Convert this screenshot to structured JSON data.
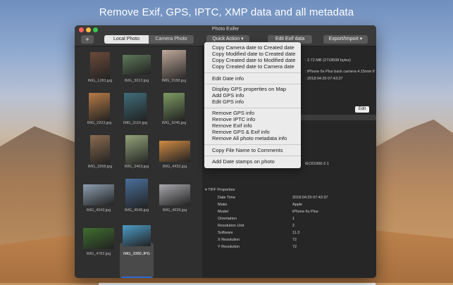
{
  "banner": "Remove Exif, GPS, IPTC, XMP data and all metadata",
  "window": {
    "title": "Photo Exifer"
  },
  "toolbar": {
    "add_label": "+",
    "segment_local": "Local Photo",
    "segment_camera": "Camera Photo",
    "quick_action": "Quick Action ▾",
    "edit_exif": "Edit Exif data",
    "export_import": "Export/Import ▾"
  },
  "photos": [
    {
      "name": "IMG_1283.jpg",
      "color": "#6b4a3a"
    },
    {
      "name": "IMG_3012.jpg",
      "color": "#5f7a5a"
    },
    {
      "name": "IMG_3188.jpg",
      "color": "#bfa89a"
    },
    {
      "name": "IMG_2223.jpg",
      "color": "#b77b47"
    },
    {
      "name": "IMG_3110.jpg",
      "color": "#3f6d7a"
    },
    {
      "name": "IMG_3245.jpg",
      "color": "#7e9b63"
    },
    {
      "name": "IMG_3268.jpg",
      "color": "#8a6b4f"
    },
    {
      "name": "IMG_3463.jpg",
      "color": "#94a47a"
    },
    {
      "name": "IMG_4432.jpg",
      "color": "#d18b44"
    },
    {
      "name": "IMG_4543.jpg",
      "color": "#8e9fb1"
    },
    {
      "name": "IMG_4546.jpg",
      "color": "#4a6f9b"
    },
    {
      "name": "IMG_4639.jpg",
      "color": "#a9a9ae"
    },
    {
      "name": "IMG_4782.jpg",
      "color": "#3f6e2e"
    },
    {
      "name": "IMG_3380.JPG",
      "color": "#4d9cc7"
    }
  ],
  "info": {
    "size": ": 2.72 MB (2718508 bytes)",
    "camera": ": iPhone 6s Plus back camera 4.15mm f/",
    "date": ": 2018:04:20 07:43:37",
    "edit": "Edit",
    "color_profile": "IEC61966-2.1"
  },
  "tiff": {
    "heading": "▾ TIFF Properties",
    "rows": [
      {
        "label": "Date Time",
        "value": "2018:04:20 07:43:37"
      },
      {
        "label": "Make",
        "value": "Apple"
      },
      {
        "label": "Model",
        "value": "iPhone 6s Plus"
      },
      {
        "label": "Orientation",
        "value": "1"
      },
      {
        "label": "Resolution Unit",
        "value": "2"
      },
      {
        "label": "Software",
        "value": "11.3"
      },
      {
        "label": "X Resolution",
        "value": "72"
      },
      {
        "label": "Y Resolution",
        "value": "72"
      }
    ]
  },
  "menu": {
    "items": [
      "Copy Camera date to Created date",
      "Copy Modified date to Created date",
      "Copy Created date to Modified date",
      "Copy Created date to Camera date",
      "Edit Date info",
      "Display GPS properties on Map",
      "Add GPS info",
      "Edit GPS  info",
      "Remove GPS info",
      "Remove IPTC info",
      "Remove Exif info",
      "Remove GPS & Exif info",
      "Remove All photo metadata info",
      "Copy File Name to Comments",
      "Add Date stamps on photo"
    ]
  }
}
